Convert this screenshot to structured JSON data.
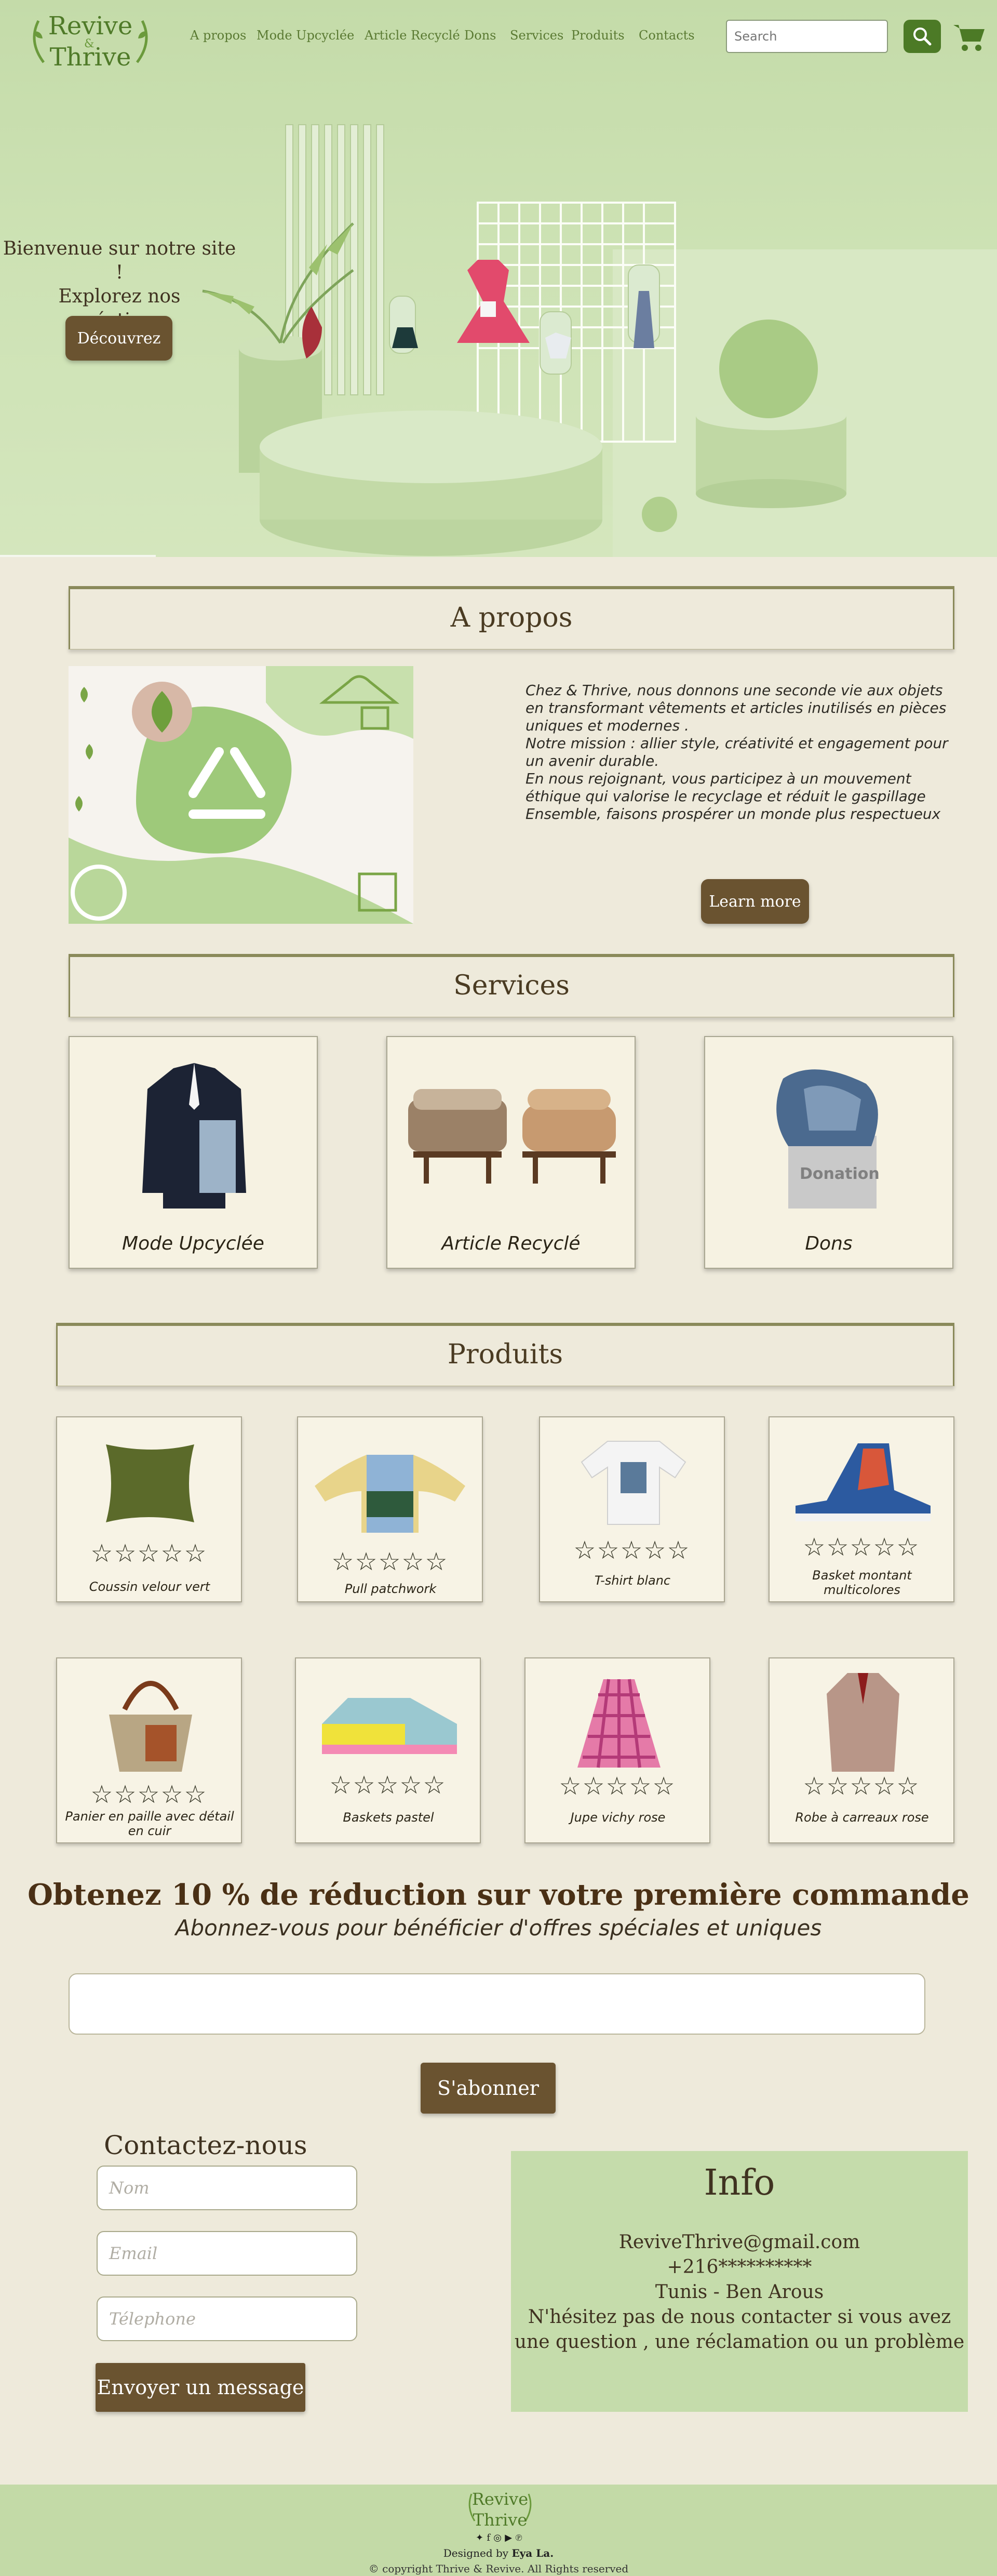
{
  "brand": {
    "line1": "Revive",
    "line2": "Thrive",
    "separator": "&"
  },
  "nav": [
    "A propos",
    "Mode Upcyclée",
    "Article Recyclé",
    "Dons",
    "Services",
    "Produits",
    "Contacts"
  ],
  "search": {
    "placeholder": "Search"
  },
  "icons": {
    "search": "search-icon",
    "cart": "cart-icon"
  },
  "hero": {
    "welcome_line1": "Bienvenue sur notre site !",
    "welcome_line2": "Explorez nos",
    "welcome_line3": "créations",
    "cta_label": "Découvrez"
  },
  "about": {
    "title": "A propos",
    "text": "Chez & Thrive, nous donnons une seconde vie aux objets\nen transformant vêtements et articles inutilisés en pièces\n uniques et modernes .\nNotre mission : allier style, créativité et engagement pour\n un avenir durable.\nEn nous rejoignant, vous participez à un mouvement\n éthique qui valorise le recyclage et réduit le gaspillage\nEnsemble, faisons prospérer un monde plus respectueux",
    "cta_label": "Learn more"
  },
  "services": {
    "title": "Services",
    "items": [
      {
        "label": "Mode Upcyclée"
      },
      {
        "label": "Article Recyclé"
      },
      {
        "label": "Dons",
        "image_text": "Donation"
      }
    ]
  },
  "products": {
    "title": "Produits",
    "stars": "☆☆☆☆☆",
    "items": [
      {
        "name": "Coussin velour vert"
      },
      {
        "name": "Pull patchwork"
      },
      {
        "name": "T-shirt blanc"
      },
      {
        "name": "Basket montant multicolores"
      },
      {
        "name": "Panier en paille avec détail en cuir"
      },
      {
        "name": "Baskets pastel"
      },
      {
        "name": "Jupe vichy rose"
      },
      {
        "name": "Robe à carreaux rose"
      }
    ]
  },
  "promo": {
    "title": "Obtenez 10 % de réduction sur votre première commande",
    "subtitle": "Abonnez-vous pour bénéficier d'offres spéciales et uniques",
    "email_value": "",
    "subscribe_label": "S'abonner"
  },
  "contact": {
    "title": "Contactez-nous",
    "name_placeholder": "Nom",
    "email_placeholder": "Email",
    "phone_placeholder": "Télephone",
    "send_label": "Envoyer un message"
  },
  "info": {
    "title": "Info",
    "email": "ReviveThrive@gmail.com",
    "phone": "+216**********",
    "address": "Tunis - Ben Arous",
    "note_line1": "N'hésitez pas de nous contacter si vous avez",
    "note_line2": "une question , une réclamation ou un problème"
  },
  "footer": {
    "designed_by": "Designed by",
    "author": "Eya La.",
    "copyright": "© copyright Thrive & Revive. All Rights reserved",
    "social": [
      "twitter-icon",
      "facebook-icon",
      "instagram-icon",
      "youtube-icon",
      "pinterest-icon"
    ]
  },
  "colors": {
    "accent": "#4c7a26",
    "button": "#6a5330",
    "background": "#eeeadb",
    "hero": "#c9dfb0"
  }
}
